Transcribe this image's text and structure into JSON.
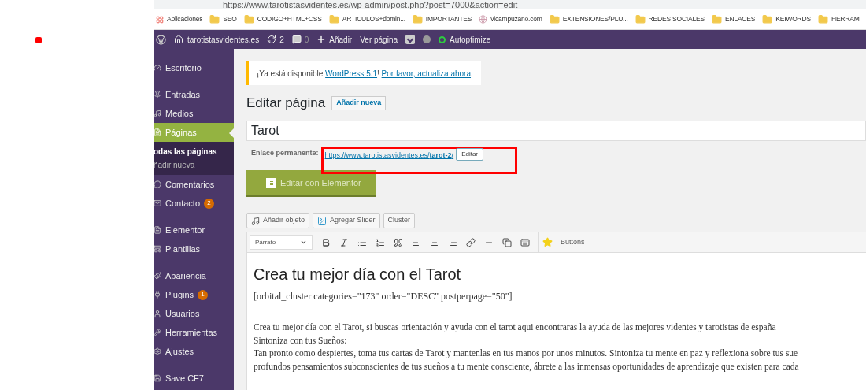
{
  "browser": {
    "url": "https://www.tarotistasvidentes.es/wp-admin/post.php?post=7000&action=edit",
    "bookmarks": [
      {
        "label": "Aplicaciones",
        "kind": "apps"
      },
      {
        "label": "SEO",
        "kind": "folder"
      },
      {
        "label": "CODIGO+HTML+CSS",
        "kind": "folder"
      },
      {
        "label": "ARTICULOS+domin...",
        "kind": "folder"
      },
      {
        "label": "IMPORTANTES",
        "kind": "folder"
      },
      {
        "label": "vicampuzano.com",
        "kind": "site"
      },
      {
        "label": "EXTENSIONES/PLU...",
        "kind": "folder"
      },
      {
        "label": "REDES SOCIALES",
        "kind": "folder"
      },
      {
        "label": "ENLACES",
        "kind": "folder"
      },
      {
        "label": "KEIWORDS",
        "kind": "folder"
      },
      {
        "label": "HERRAM",
        "kind": "folder"
      }
    ]
  },
  "admin_bar": {
    "site": "tarotistasvidentes.es",
    "updates": "2",
    "comments": "0",
    "add": "Añadir",
    "view": "Ver página",
    "autoptimize": "Autoptimize"
  },
  "sidebar": {
    "groups": [
      {
        "items": [
          {
            "label": "Escritorio",
            "selected": false
          }
        ]
      },
      {
        "items": [
          {
            "label": "Entradas",
            "selected": false
          },
          {
            "label": "Medios",
            "selected": false
          },
          {
            "label": "Páginas",
            "selected": true,
            "children": [
              {
                "label": "odas las páginas",
                "selected": true
              },
              {
                "label": "ñadir nueva",
                "selected": false
              }
            ]
          },
          {
            "label": "Comentarios",
            "selected": false
          },
          {
            "label": "Contacto",
            "selected": false,
            "badge": "2"
          }
        ]
      },
      {
        "items": [
          {
            "label": "Elementor",
            "selected": false
          },
          {
            "label": "Plantillas",
            "selected": false
          }
        ]
      },
      {
        "items": [
          {
            "label": "Apariencia",
            "selected": false
          },
          {
            "label": "Plugins",
            "selected": false,
            "badge": "1"
          },
          {
            "label": "Usuarios",
            "selected": false
          },
          {
            "label": "Herramientas",
            "selected": false
          },
          {
            "label": "Ajustes",
            "selected": false
          }
        ]
      },
      {
        "items": [
          {
            "label": "Save CF7",
            "selected": false
          }
        ]
      }
    ]
  },
  "notice": {
    "text_before": "¡Ya está disponible ",
    "link1": "WordPress 5.1",
    "text_middle": "! ",
    "link2": "Por favor, actualiza ahora",
    "text_after": "."
  },
  "heading": "Editar página",
  "add_new": "Añadir nueva",
  "title_field": {
    "value": "Tarot"
  },
  "permalink": {
    "label": "Enlace permanente:",
    "url": "https://www.tarotistasvidentes.es/",
    "slug": "tarot-2",
    "trail": "/",
    "edit": "Editar"
  },
  "elementor_button": "Editar con Elementor",
  "media_buttons": [
    {
      "label": "Añadir objeto",
      "kind": "media"
    },
    {
      "label": "Agregar Slider",
      "kind": "slider"
    },
    {
      "label": "Cluster",
      "kind": "plain"
    }
  ],
  "toolbar": {
    "format": "Párrafo",
    "buttons_label": "Buttons"
  },
  "content": {
    "heading": "Crea tu mejor día con el Tarot",
    "shortcode": "[orbital_cluster categories=\"173\" order=\"DESC\" postperpage=\"50\"]",
    "lines": [
      "Crea tu mejor día con el Tarot, si buscas orientación y ayuda con el tarot aqui encontraras la ayuda de las mejores videntes y tarotistas de españa",
      "Sintoniza con tus Sueños:",
      "Tan pronto como despiertes, toma tus cartas de Tarot y mantenlas en tus manos por unos minutos. Sintoniza tu mente en paz y reflexiona sobre tus sue",
      "profundos pensamientos subconscientes de tus sueños a tu mente consciente, ábrete a las inmensas oportunidades de aprendizaje que existen para cada"
    ]
  }
}
